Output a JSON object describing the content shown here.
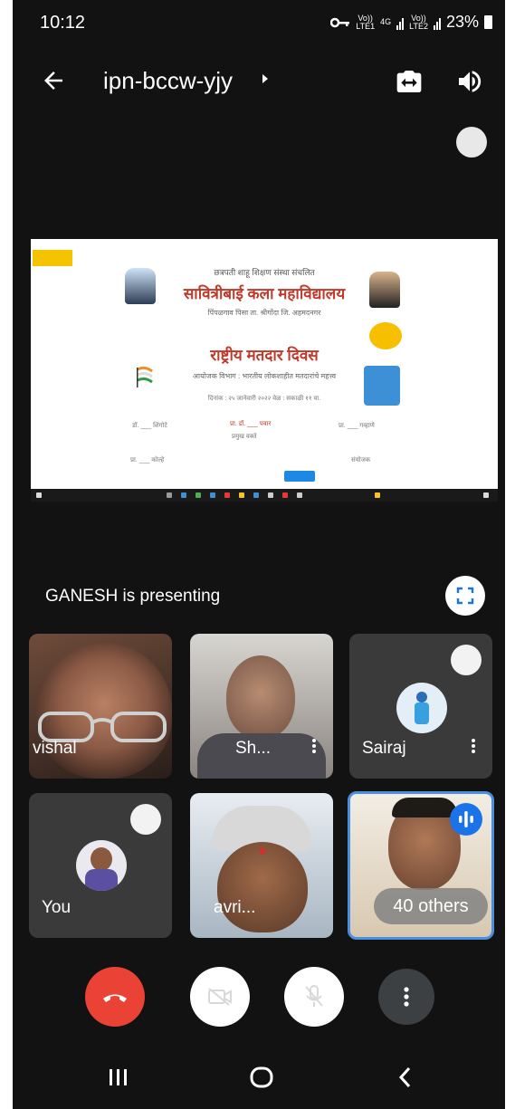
{
  "status_bar": {
    "time": "10:12",
    "sim1_label_top": "Vo))",
    "sim1_label_bottom": "LTE1",
    "network": "4G",
    "sim2_label_top": "Vo))",
    "sim2_label_bottom": "LTE2",
    "battery": "23%",
    "icons": [
      "vpn-key-icon",
      "signal-icon",
      "battery-icon"
    ]
  },
  "app_bar": {
    "meeting_code": "ipn-bccw-yjy",
    "icons": [
      "back-arrow-icon",
      "chevron-right-icon",
      "switch-camera-icon",
      "speaker-icon"
    ]
  },
  "presentation": {
    "slide_lines": {
      "header_small": "छत्रपती शाहू शिक्षण संस्था संचलित",
      "college_name": "सावित्रीबाई कला महाविद्यालय",
      "subline": "पिंपळगाव पिसा ता. श्रीगोंदा जि. अहमदनगर",
      "event_title": "राष्ट्रीय मतदार दिवस",
      "event_sub": "आयोजक विभाग : भारतीय लोकशाहीत मतदारांचे महत्त्व",
      "event_date": "दिनांक : २५ जानेवारी २०२२ वेळ : सकाळी ११ वा.",
      "speaker1": "डॉ. ___ शिंगोटे",
      "speaker2": "प्रा. डॉ. ___ पवार",
      "speaker3": "प्रा. ___ गव्हाणे",
      "speaker2_role": "प्रमुख वक्ते",
      "footer_left": "प्रा. ___ कोल्हे",
      "footer_right": "संयोजक"
    },
    "presenter_text": "GANESH is presenting"
  },
  "participants": [
    {
      "name": "vishal",
      "type": "video"
    },
    {
      "name": "Sh...",
      "type": "video"
    },
    {
      "name": "Sairaj",
      "type": "avatar"
    },
    {
      "name": "You",
      "type": "avatar"
    },
    {
      "name": "avri...",
      "type": "video"
    },
    {
      "name": "40 others",
      "type": "others",
      "speaking": true
    }
  ],
  "controls": {
    "icons": [
      "end-call-icon",
      "camera-off-icon",
      "mic-off-icon",
      "more-vert-icon"
    ]
  },
  "nav_bar": {
    "icons": [
      "recent-apps-icon",
      "home-icon",
      "back-icon"
    ]
  },
  "colors": {
    "background": "#121212",
    "tile": "#3a3a3a",
    "hangup": "#ea4335",
    "speaking_border": "#4a90e2",
    "speaking_badge": "#1a73e8"
  }
}
